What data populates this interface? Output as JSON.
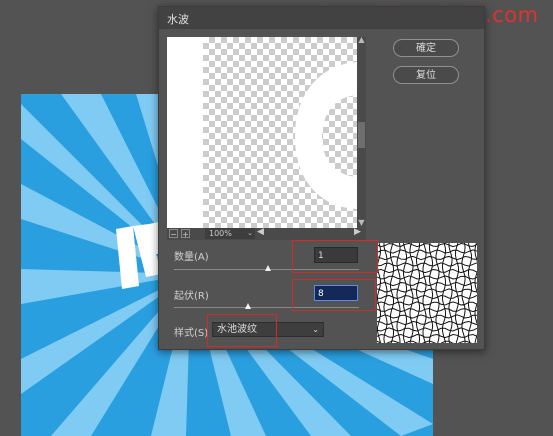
{
  "dialog": {
    "title": "水波",
    "ok_label": "確定",
    "reset_label": "复位"
  },
  "preview": {
    "zoom": "100%",
    "zoom_out_glyph": "−",
    "zoom_in_glyph": "+"
  },
  "params": {
    "amount_label": "数量(A)",
    "amount_value": "1",
    "ridges_label": "起伏(R)",
    "ridges_value": "8",
    "style_label": "样式(S)",
    "style_value": "水池波纹"
  },
  "watermark": "www.haoyidianshejji.com",
  "colors": {
    "highlight": "#d42a2a",
    "canvas_blue": "#2a9fe0"
  },
  "icons": {
    "dropdown": "chevron-down-icon",
    "scroll_left": "triangle-left-icon",
    "scroll_right": "triangle-right-icon",
    "scroll_up": "triangle-up-icon",
    "scroll_down": "triangle-down-icon"
  }
}
